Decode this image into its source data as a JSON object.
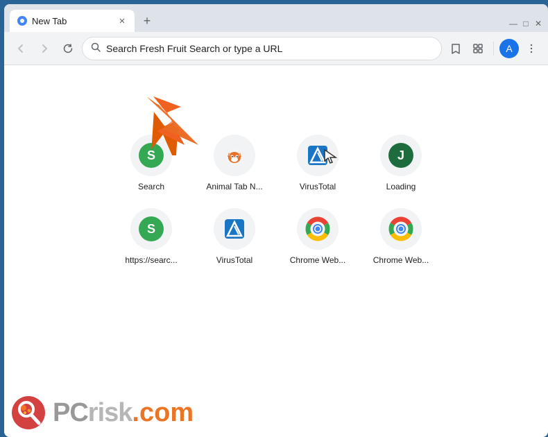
{
  "window": {
    "title": "New Tab",
    "minimize_label": "—",
    "maximize_label": "□",
    "close_label": "✕"
  },
  "tab": {
    "title": "New Tab",
    "new_tab_label": "+"
  },
  "toolbar": {
    "back_label": "←",
    "forward_label": "→",
    "reload_label": "↻",
    "address_placeholder": "Search Fresh Fruit Search or type a URL",
    "address_value": "Search Fresh Fruit Search or type a URL",
    "bookmark_label": "☆",
    "extensions_label": "🧩",
    "profile_label": "A",
    "menu_label": "⋮"
  },
  "speed_dial": {
    "items": [
      {
        "id": "search",
        "label": "Search",
        "type": "s-green"
      },
      {
        "id": "animal-tab",
        "label": "Animal Tab N...",
        "type": "animal"
      },
      {
        "id": "virustotal-1",
        "label": "VirusTotal",
        "type": "vt"
      },
      {
        "id": "loading",
        "label": "Loading",
        "type": "j-green"
      },
      {
        "id": "https-search",
        "label": "https://searc...",
        "type": "s-green"
      },
      {
        "id": "virustotal-2",
        "label": "VirusTotal",
        "type": "vt"
      },
      {
        "id": "chrome-web-1",
        "label": "Chrome Web...",
        "type": "chrome"
      },
      {
        "id": "chrome-web-2",
        "label": "Chrome Web...",
        "type": "chrome"
      }
    ]
  },
  "watermark": {
    "site": "PCrisk",
    "site_colored": ".com",
    "full": "PC risk.com"
  }
}
